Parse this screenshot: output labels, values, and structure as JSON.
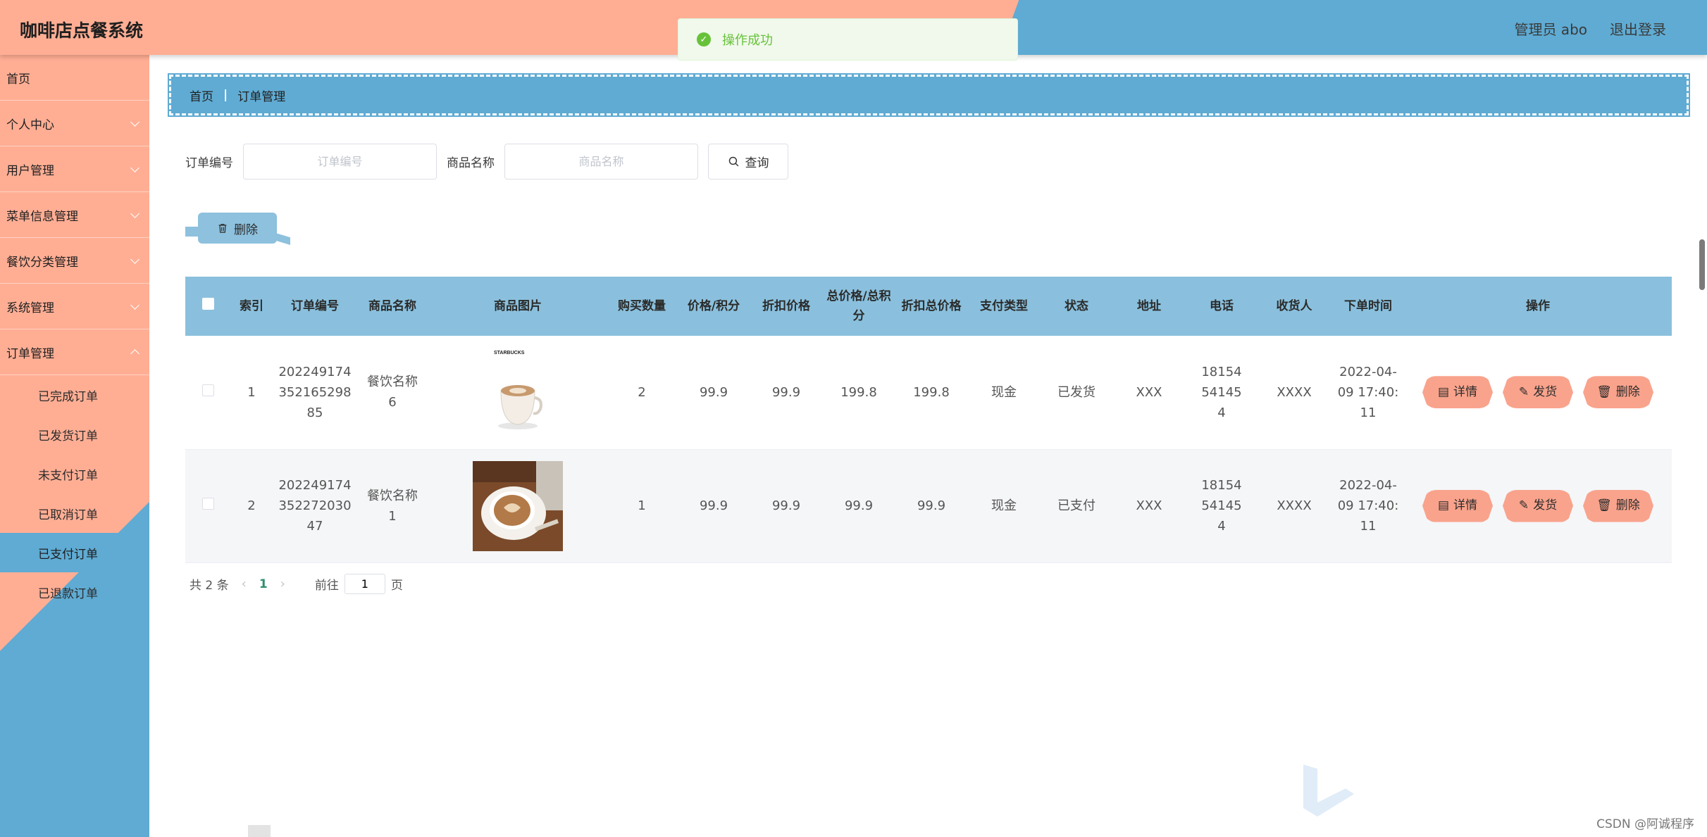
{
  "app": {
    "title": "咖啡店点餐系统"
  },
  "header": {
    "admin_label": "管理员 abo",
    "logout_label": "退出登录"
  },
  "toast": {
    "message": "操作成功",
    "icon": "check-circle-icon"
  },
  "sidebar": {
    "items": [
      {
        "label": "首页"
      },
      {
        "label": "个人中心"
      },
      {
        "label": "用户管理"
      },
      {
        "label": "菜单信息管理"
      },
      {
        "label": "餐饮分类管理"
      },
      {
        "label": "系统管理"
      },
      {
        "label": "订单管理"
      }
    ],
    "submenu": [
      {
        "label": "已完成订单"
      },
      {
        "label": "已发货订单"
      },
      {
        "label": "未支付订单"
      },
      {
        "label": "已取消订单"
      },
      {
        "label": "已支付订单"
      },
      {
        "label": "已退款订单"
      }
    ]
  },
  "breadcrumb": {
    "home": "首页",
    "current": "订单管理",
    "separator": "|"
  },
  "search": {
    "order_no_label": "订单编号",
    "order_no_placeholder": "订单编号",
    "product_name_label": "商品名称",
    "product_name_placeholder": "商品名称",
    "button_label": "查询"
  },
  "toolbar": {
    "delete_label": "删除"
  },
  "table": {
    "headers": {
      "index": "索引",
      "order_no": "订单编号",
      "product_name": "商品名称",
      "product_image": "商品图片",
      "qty": "购买数量",
      "price": "价格/积分",
      "discount_price": "折扣价格",
      "total": "总价格/总积分",
      "discount_total": "折扣总价格",
      "pay_type": "支付类型",
      "status": "状态",
      "address": "地址",
      "phone": "电话",
      "receiver": "收货人",
      "order_time": "下单时间",
      "actions": "操作"
    },
    "rows": [
      {
        "index": "1",
        "order_no": "20224917435216529885",
        "product_name": "餐饮名称6",
        "qty": "2",
        "price": "99.9",
        "discount_price": "99.9",
        "total": "199.8",
        "discount_total": "199.8",
        "pay_type": "现金",
        "status": "已发货",
        "address": "XXX",
        "phone": "18154541454",
        "receiver": "XXXX",
        "order_time": "2022-04-09 17:40:11",
        "image_brand": "STARBUCKS"
      },
      {
        "index": "2",
        "order_no": "20224917435227203047",
        "product_name": "餐饮名称1",
        "qty": "1",
        "price": "99.9",
        "discount_price": "99.9",
        "total": "99.9",
        "discount_total": "99.9",
        "pay_type": "现金",
        "status": "已支付",
        "address": "XXX",
        "phone": "18154541454",
        "receiver": "XXXX",
        "order_time": "2022-04-09 17:40:11"
      }
    ],
    "actions": {
      "detail": "详情",
      "ship": "发货",
      "delete": "删除"
    }
  },
  "pagination": {
    "total_text": "共 2 条",
    "current_page": "1",
    "goto_label": "前往",
    "page_suffix": "页",
    "goto_value": "1"
  },
  "watermark": "CSDN @阿诚程序",
  "colors": {
    "peach": "#ffae94",
    "blue": "#5fabd3",
    "table_header": "#8ac0dd",
    "action_button": "#f9a38c",
    "success": "#67c23a"
  }
}
